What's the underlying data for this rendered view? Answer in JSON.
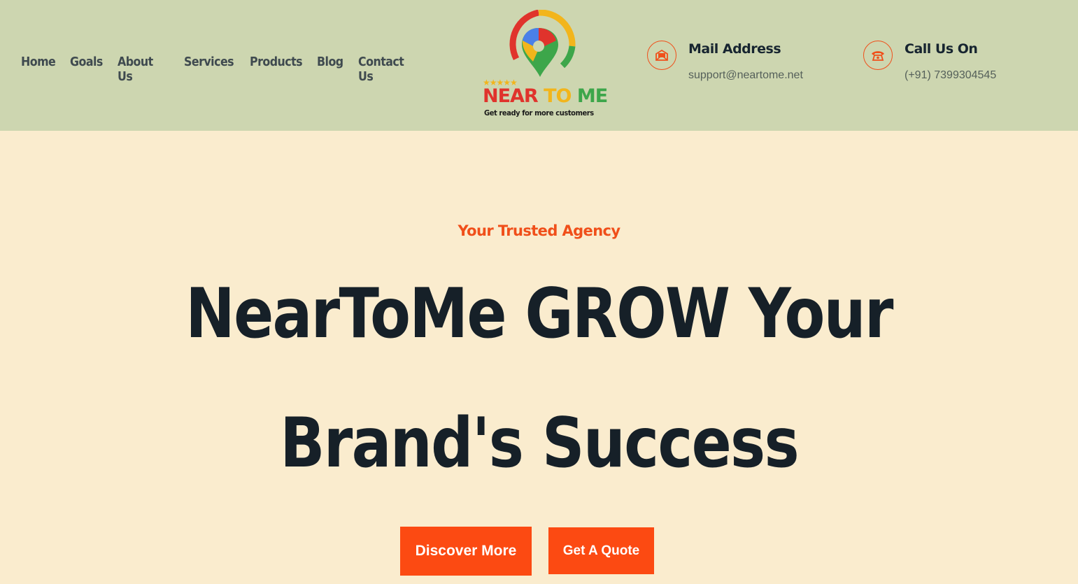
{
  "nav": {
    "items": [
      "Home",
      "Goals",
      "About Us",
      "Services",
      "Products",
      "Blog",
      "Contact Us"
    ]
  },
  "logo": {
    "word1": "NEAR",
    "word2": "TO",
    "word3": "ME",
    "tagline": "Get ready for more customers",
    "stars": "★★★★★"
  },
  "contact": {
    "mail": {
      "title": "Mail Address",
      "value": "support@neartome.net",
      "icon": "mail-icon"
    },
    "call": {
      "title": "Call Us On",
      "value": "(+91) 7399304545",
      "icon": "phone-icon"
    }
  },
  "hero": {
    "subtitle": "Your Trusted Agency",
    "title_line1": "NearToMe GROW Your",
    "title_line2": "Brand's Success",
    "discover_label": "Discover More",
    "quote_label": "Get A Quote"
  },
  "colors": {
    "header_bg": "#cdd6b0",
    "page_bg": "#faecce",
    "accent": "#fc4a12",
    "heading": "#162028"
  }
}
